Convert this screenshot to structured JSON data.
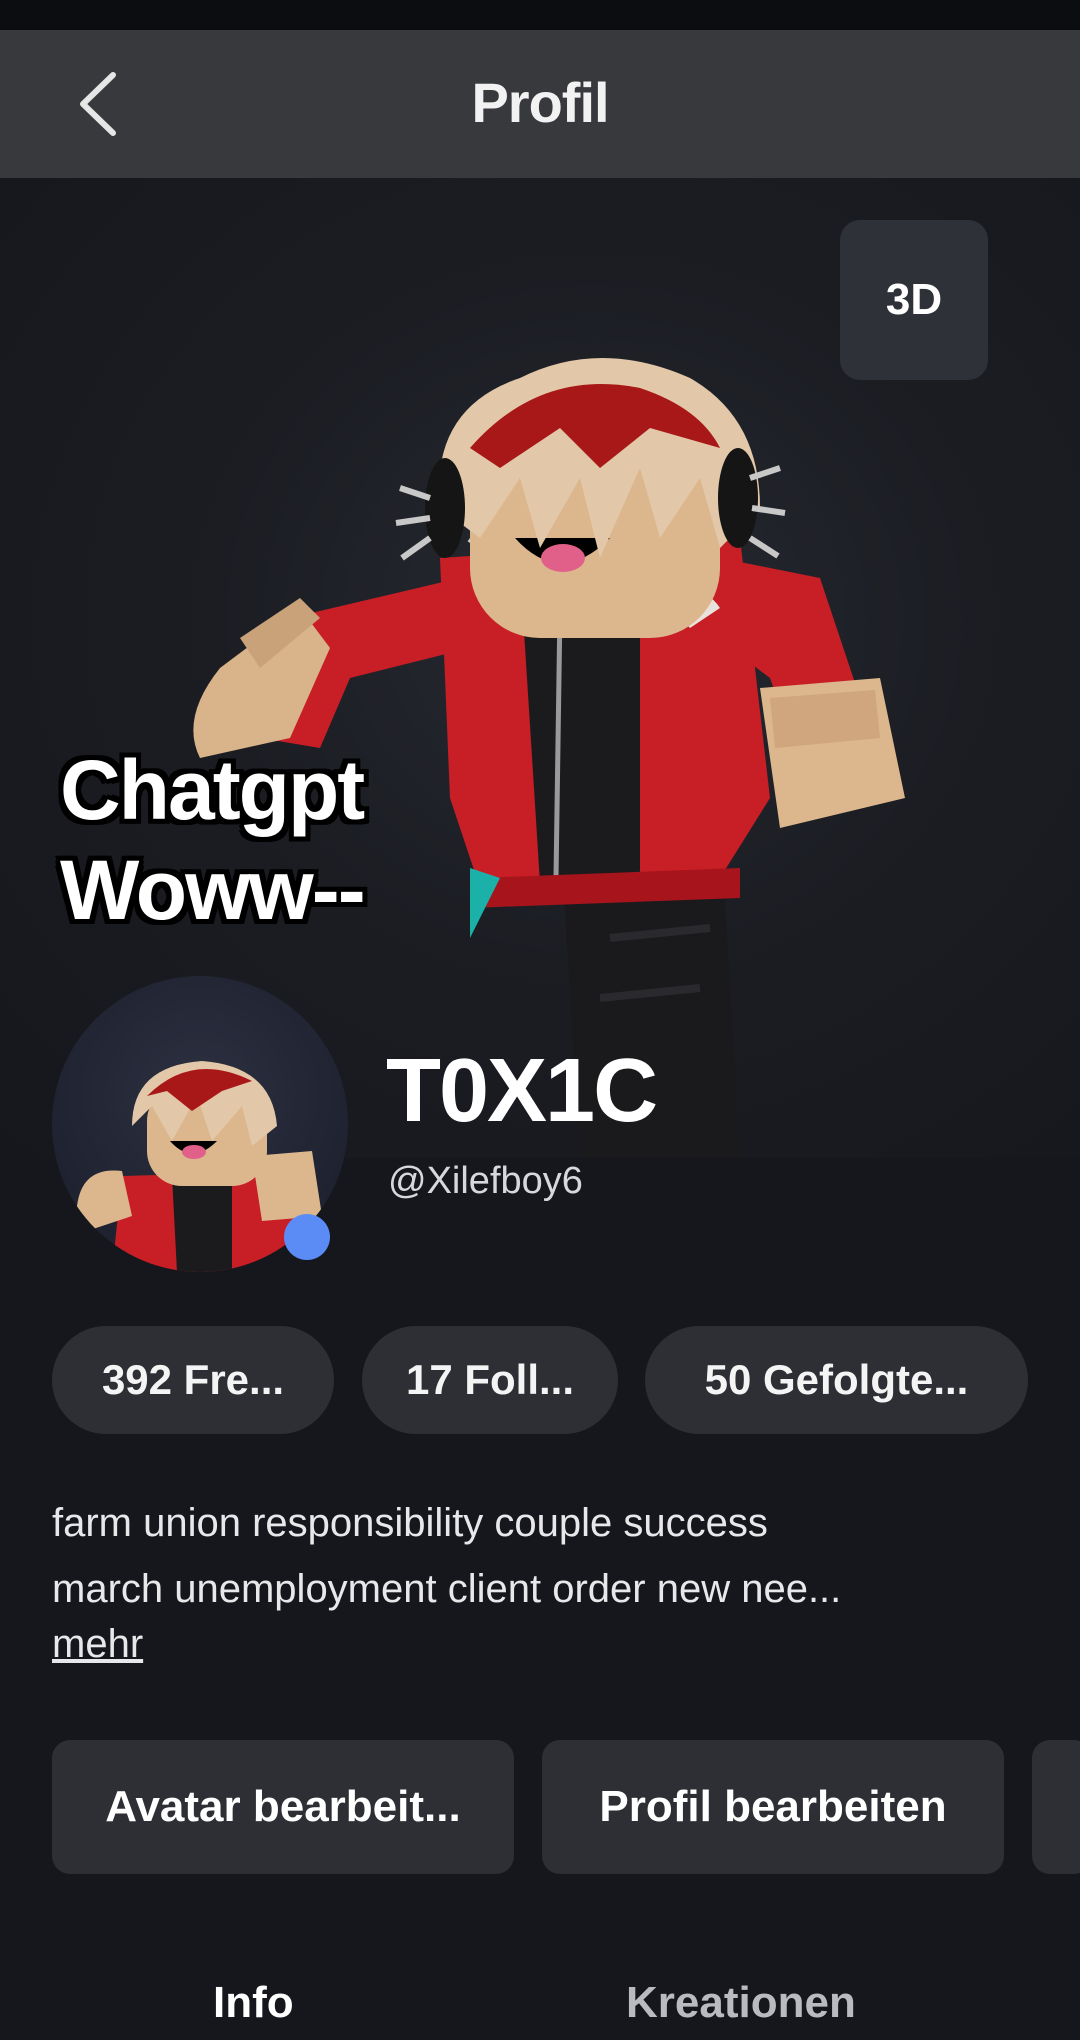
{
  "header": {
    "title": "Profil",
    "back_icon": "chevron-left-icon"
  },
  "hero": {
    "view_3d_label": "3D"
  },
  "overlay_caption": {
    "line1": "Chatgpt",
    "line2": "Woww--"
  },
  "profile": {
    "display_name": "T0X1C",
    "username": "@Xilefboy6",
    "online_status_color": "#5b8cf5"
  },
  "stats": [
    {
      "label": "392 Fre..."
    },
    {
      "label": "17 Foll..."
    },
    {
      "label": "50 Gefolgte..."
    }
  ],
  "bio": {
    "line1": "farm union responsibility couple success",
    "line2": "march unemployment client order new nee...",
    "more_label": "mehr"
  },
  "actions": [
    {
      "label": "Avatar bearbeit..."
    },
    {
      "label": "Profil bearbeiten"
    }
  ],
  "tabs": [
    {
      "label": "Info",
      "active": true
    },
    {
      "label": "Kreationen",
      "active": false
    }
  ],
  "colors": {
    "background": "#15171c",
    "header_bg": "#38393d",
    "chip_bg": "#2d2f35",
    "inactive_tab": "#b9bbc0"
  }
}
